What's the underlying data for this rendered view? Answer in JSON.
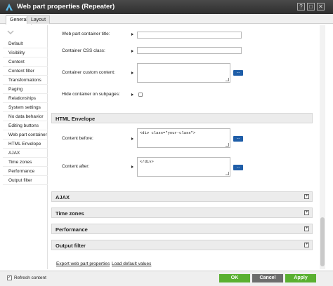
{
  "window": {
    "title": "Web part properties (Repeater)",
    "buttons": [
      "?",
      "□",
      "✕"
    ]
  },
  "tabs": [
    "General",
    "Layout"
  ],
  "sidebar": {
    "items": [
      "Default",
      "Visibility",
      "Content",
      "Content filter",
      "Transformations",
      "Paging",
      "Relationships",
      "System settings",
      "No data behavior",
      "Editing buttons",
      "Web part container",
      "HTML Envelope",
      "AJAX",
      "Time zones",
      "Performance",
      "Output filter"
    ]
  },
  "container_fields": {
    "title_label": "Web part container title:",
    "css_label": "Container CSS class:",
    "custom_label": "Container custom content:",
    "hide_label": "Hide container on subpages:",
    "dots": "..."
  },
  "html_envelope": {
    "title": "HTML Envelope",
    "before_label": "Content before:",
    "before_value": "<div class=\"your-class\">",
    "after_label": "Content after:",
    "after_value": "</div>"
  },
  "sections": [
    "AJAX",
    "Time zones",
    "Performance",
    "Output filter"
  ],
  "links": {
    "export": "Export web part properties",
    "load_defaults": "Load default values"
  },
  "footer": {
    "refresh_label": "Refresh content",
    "refresh_checked": true,
    "ok": "OK",
    "cancel": "Cancel",
    "apply": "Apply"
  },
  "colors": {
    "titlebar": "#2e2e2e",
    "accent_green": "#5ab031",
    "dots_button": "#1f5ea8"
  }
}
